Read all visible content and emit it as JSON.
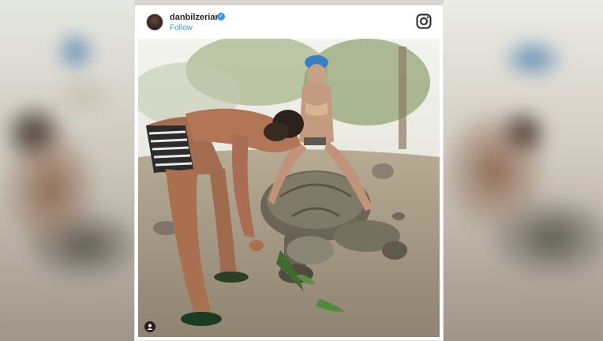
{
  "post": {
    "username": "danbilzerian",
    "verified_mark": "✓",
    "follow_label": "Follow",
    "icons": {
      "avatar": "profile-avatar",
      "instagram": "instagram-logo-icon",
      "verified": "verified-badge-icon",
      "user_tag": "user-tag-icon"
    }
  },
  "colors": {
    "link": "#3897f0",
    "username": "#262626",
    "card_background": "#ffffff"
  }
}
